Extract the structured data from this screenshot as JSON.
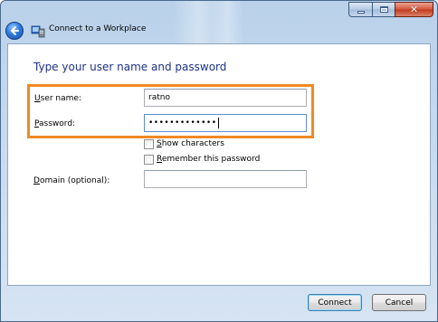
{
  "window": {
    "title": "Connect to a Workplace",
    "controls": {
      "minimize_icon": "minimize-icon",
      "maximize_icon": "maximize-icon",
      "close_glyph": "✕"
    }
  },
  "form": {
    "heading": "Type your user name and password",
    "username": {
      "label_mnemonic": "U",
      "label_rest": "ser name:",
      "value": "ratno"
    },
    "password": {
      "label_mnemonic": "P",
      "label_rest": "assword:",
      "masked_value": "•••••••••••••"
    },
    "show_characters": {
      "label_mnemonic": "S",
      "label_rest": "how characters",
      "checked": false
    },
    "remember_password": {
      "label_mnemonic": "R",
      "label_rest": "emember this password",
      "checked": false
    },
    "domain": {
      "label_mnemonic": "D",
      "label_rest": "omain (optional):",
      "value": ""
    }
  },
  "buttons": {
    "connect": "Connect",
    "cancel": "Cancel"
  },
  "colors": {
    "heading": "#1e3287",
    "highlight": "#f08a24",
    "glass": "#c7dbef"
  }
}
